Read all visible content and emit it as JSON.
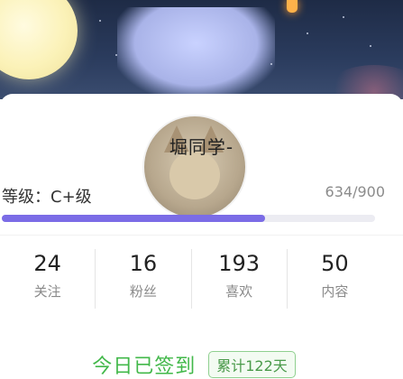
{
  "profile": {
    "username": "堀同学-",
    "avatar_icon": "avatar-image"
  },
  "level": {
    "label": "等级：C+级",
    "value_text": "634/900",
    "progress_fraction": 0.7044
  },
  "stats": [
    {
      "value": "24",
      "label": "关注"
    },
    {
      "value": "16",
      "label": "粉丝"
    },
    {
      "value": "193",
      "label": "喜欢"
    },
    {
      "value": "50",
      "label": "内容"
    }
  ],
  "checkin": {
    "status_text": "今日已签到",
    "badge_text": "累计122天"
  },
  "colors": {
    "accent_purple": "#7b6ce6",
    "checkin_green": "#42b84a"
  }
}
